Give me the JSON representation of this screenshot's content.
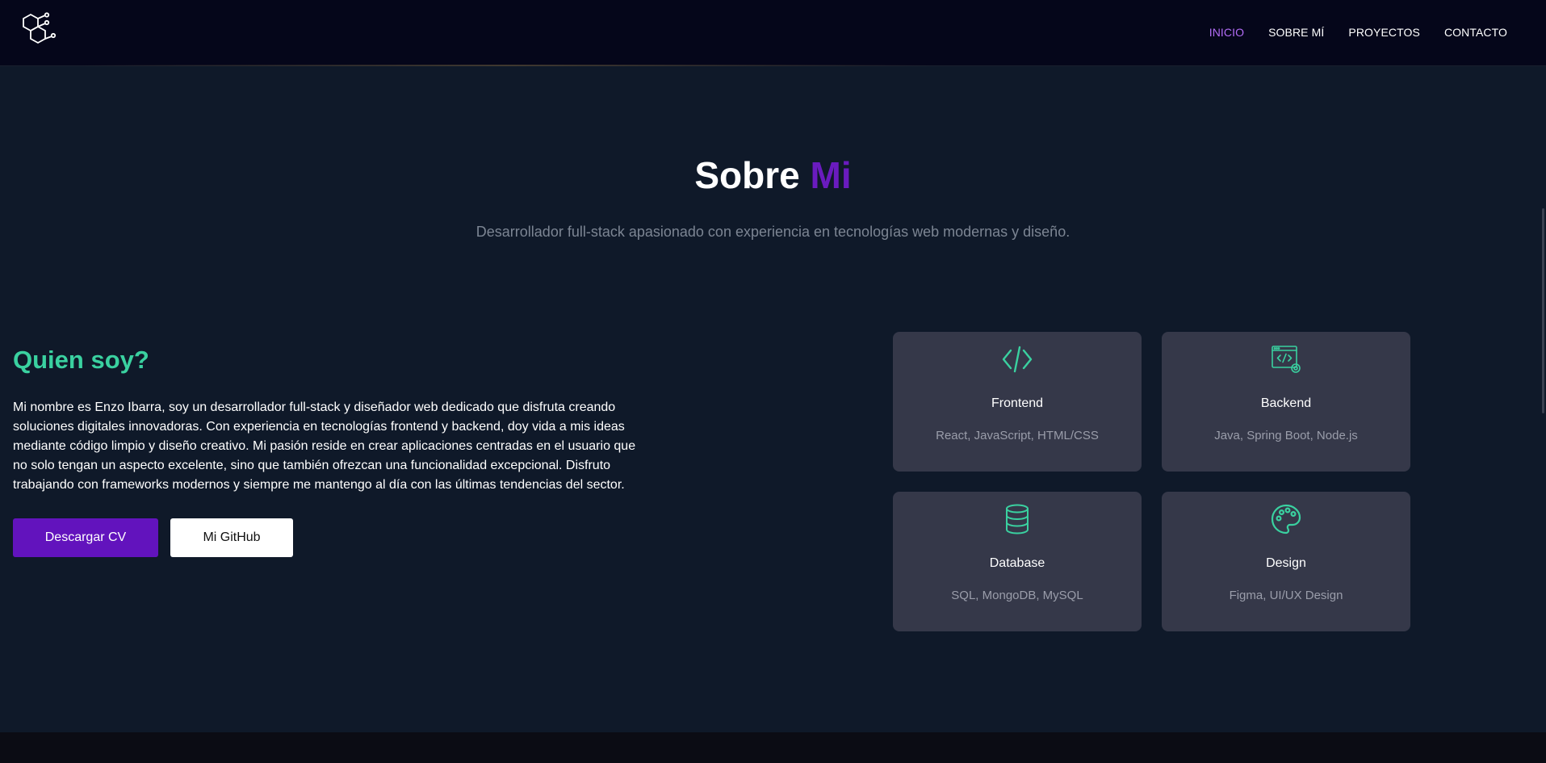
{
  "nav": {
    "links": [
      "INICIO",
      "SOBRE MÍ",
      "PROYECTOS",
      "CONTACTO"
    ],
    "active": "INICIO",
    "active_color": "#b26cf5"
  },
  "section": {
    "title_main": "Sobre",
    "title_accent": "Mi",
    "accent_color": "#6a1bbf",
    "subtitle": "Desarrollador full-stack apasionado con experiencia en tecnologías web modernas y diseño."
  },
  "about": {
    "heading": "Quien soy?",
    "heading_color": "#3ad1a0",
    "paragraph": "Mi nombre es Enzo Ibarra, soy un desarrollador full-stack y diseñador web dedicado que disfruta creando soluciones digitales innovadoras. Con experiencia en tecnologías frontend y backend, doy vida a mis ideas mediante código limpio y diseño creativo. Mi pasión reside en crear aplicaciones centradas en el usuario que no solo tengan un aspecto excelente, sino que también ofrezcan una funcionalidad excepcional. Disfruto trabajando con frameworks modernos y siempre me mantengo al día con las últimas tendencias del sector.",
    "cv_button": "Descargar CV",
    "github_button": "Mi GitHub"
  },
  "skills": [
    {
      "title": "Frontend",
      "desc": "React, JavaScript, HTML/CSS",
      "icon": "code-icon"
    },
    {
      "title": "Backend",
      "desc": "Java, Spring Boot, Node.js",
      "icon": "server-code-icon"
    },
    {
      "title": "Database",
      "desc": "SQL, MongoDB, MySQL",
      "icon": "database-icon"
    },
    {
      "title": "Design",
      "desc": "Figma, UI/UX Design",
      "icon": "palette-icon"
    }
  ],
  "colors": {
    "navbar_bg": "#05061a",
    "page_bg": "#0f1929",
    "card_bg": "#353849",
    "icon_color": "#3ad1a0",
    "cv_button_bg": "#6213bd"
  }
}
